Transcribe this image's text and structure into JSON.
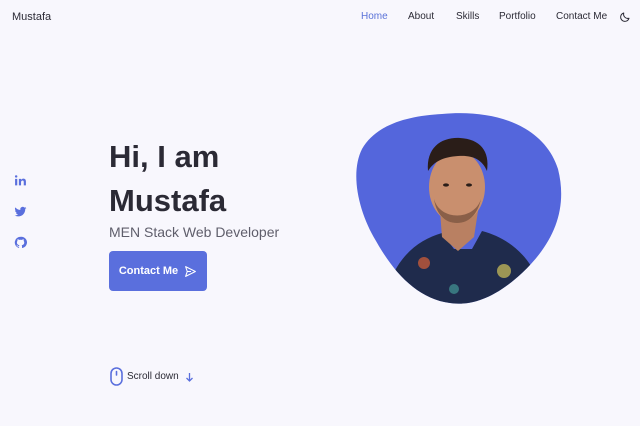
{
  "header": {
    "logo": "Mustafa",
    "nav": [
      {
        "label": "Home",
        "active": true
      },
      {
        "label": "About",
        "active": false
      },
      {
        "label": "Skills",
        "active": false
      },
      {
        "label": "Portfolio",
        "active": false
      },
      {
        "label": "Contact Me",
        "active": false
      }
    ],
    "theme_toggle_icon": "moon-icon"
  },
  "social": {
    "icons": [
      "linkedin-icon",
      "twitter-icon",
      "github-icon"
    ]
  },
  "hero": {
    "title_line1": "Hi, I am",
    "title_line2": "Mustafa",
    "subtitle": "MEN Stack Web Developer",
    "cta_label": "Contact Me",
    "cta_icon": "send-icon"
  },
  "scroll": {
    "label": "Scroll down",
    "mouse_icon": "mouse-icon",
    "arrow_icon": "arrow-down-icon"
  },
  "colors": {
    "accent": "#5a6fdd",
    "background": "#f8f7fd",
    "text": "#2b2a35",
    "subtitle": "#5f5e6b"
  }
}
